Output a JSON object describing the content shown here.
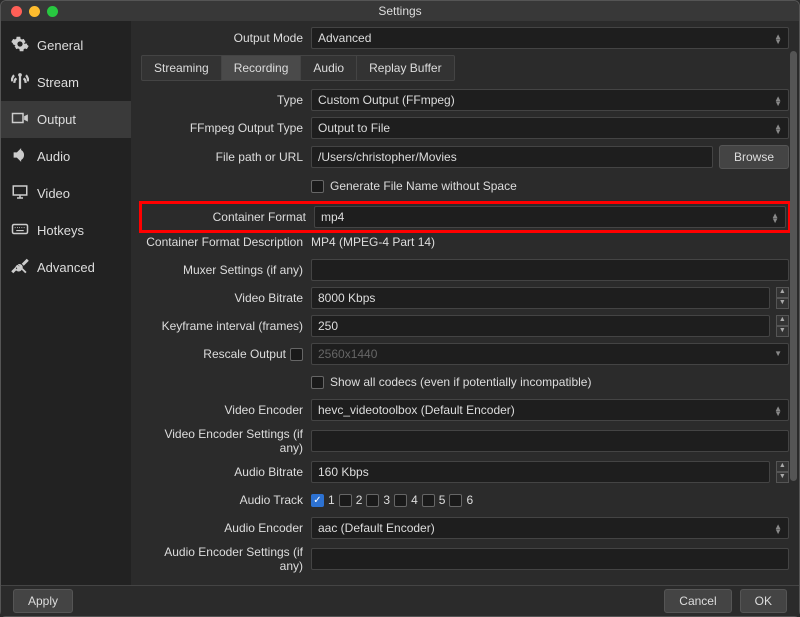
{
  "title": "Settings",
  "sidebar": {
    "items": [
      {
        "label": "General"
      },
      {
        "label": "Stream"
      },
      {
        "label": "Output"
      },
      {
        "label": "Audio"
      },
      {
        "label": "Video"
      },
      {
        "label": "Hotkeys"
      },
      {
        "label": "Advanced"
      }
    ]
  },
  "output_mode": {
    "label": "Output Mode",
    "value": "Advanced"
  },
  "tabs": [
    "Streaming",
    "Recording",
    "Audio",
    "Replay Buffer"
  ],
  "fields": {
    "type": {
      "label": "Type",
      "value": "Custom Output (FFmpeg)"
    },
    "ffmpeg_output_type": {
      "label": "FFmpeg Output Type",
      "value": "Output to File"
    },
    "file_path": {
      "label": "File path or URL",
      "value": "/Users/christopher/Movies",
      "browse": "Browse"
    },
    "gen_no_space": {
      "label": "Generate File Name without Space",
      "checked": false
    },
    "container_format": {
      "label": "Container Format",
      "value": "mp4"
    },
    "container_desc": {
      "label": "Container Format Description",
      "value": "MP4 (MPEG-4 Part 14)"
    },
    "muxer_settings": {
      "label": "Muxer Settings (if any)",
      "value": ""
    },
    "video_bitrate": {
      "label": "Video Bitrate",
      "value": "8000 Kbps"
    },
    "keyframe": {
      "label": "Keyframe interval (frames)",
      "value": "250"
    },
    "rescale": {
      "label": "Rescale Output",
      "checked": false,
      "placeholder": "2560x1440"
    },
    "show_all": {
      "label": "Show all codecs (even if potentially incompatible)",
      "checked": false
    },
    "video_encoder": {
      "label": "Video Encoder",
      "value": "hevc_videotoolbox (Default Encoder)"
    },
    "video_encoder_settings": {
      "label": "Video Encoder Settings (if any)",
      "value": ""
    },
    "audio_bitrate": {
      "label": "Audio Bitrate",
      "value": "160 Kbps"
    },
    "audio_track": {
      "label": "Audio Track",
      "tracks": [
        "1",
        "2",
        "3",
        "4",
        "5",
        "6"
      ],
      "checked": [
        true,
        false,
        false,
        false,
        false,
        false
      ]
    },
    "audio_encoder": {
      "label": "Audio Encoder",
      "value": "aac (Default Encoder)"
    },
    "audio_encoder_settings": {
      "label": "Audio Encoder Settings (if any)",
      "value": ""
    }
  },
  "buttons": {
    "apply": "Apply",
    "cancel": "Cancel",
    "ok": "OK"
  }
}
